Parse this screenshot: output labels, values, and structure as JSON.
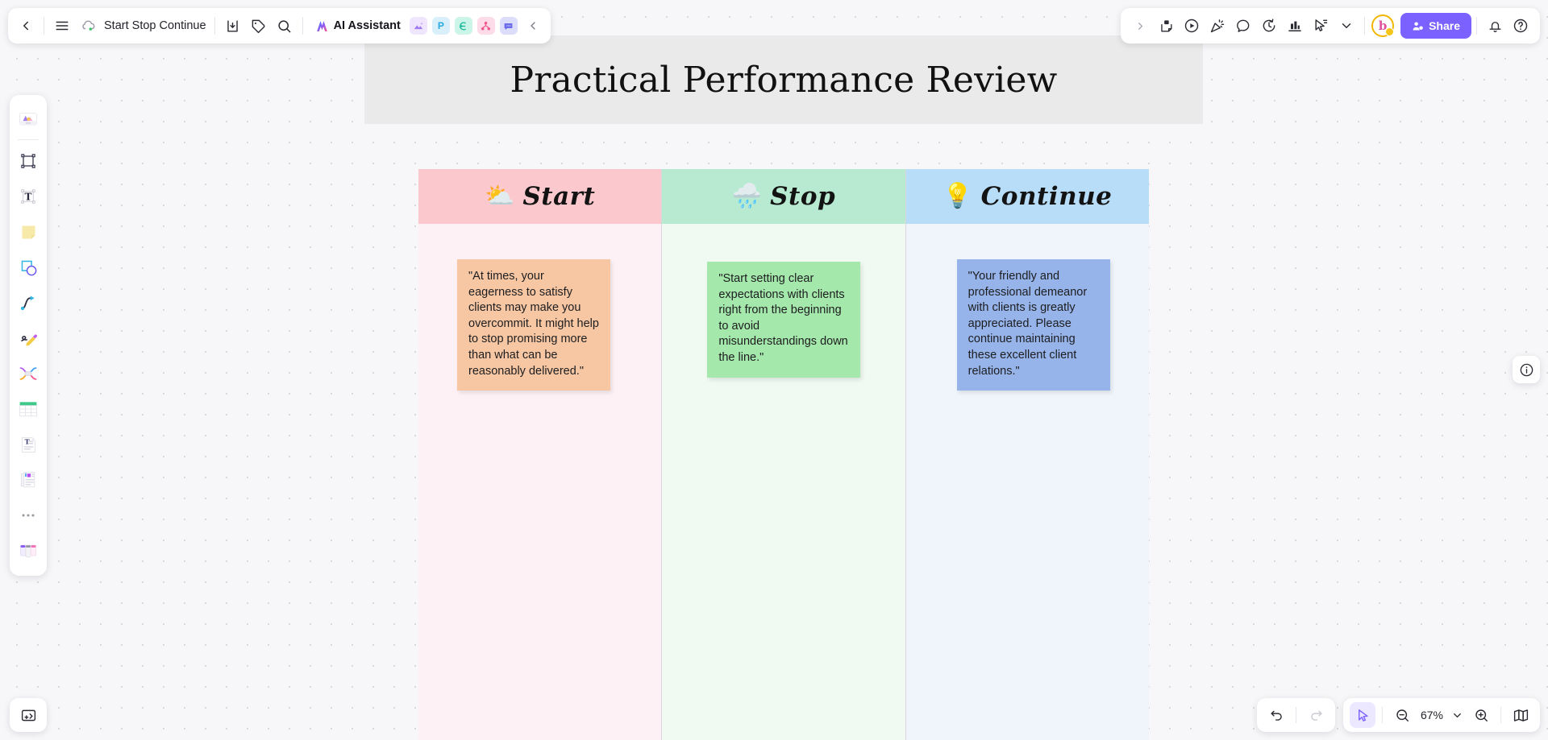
{
  "app": {
    "file_name": "Start Stop Continue",
    "zoom_level": "67%"
  },
  "topbar": {
    "back_label": "Back",
    "menu_label": "Menu",
    "cloud_status_label": "Saved to cloud",
    "import_label": "Import",
    "tag_label": "Tag",
    "search_label": "Search",
    "ai_assistant_label": "AI Assistant",
    "apps": [
      {
        "name": "image-generator-app",
        "glyph": "",
        "bg": "#efe6fd",
        "fg": "#9b6bf0"
      },
      {
        "name": "presentation-app",
        "glyph": "P",
        "bg": "#d9f0fb",
        "fg": "#2aa8e0"
      },
      {
        "name": "flowchart-app",
        "glyph": "",
        "bg": "#ccf5ea",
        "fg": "#17b897"
      },
      {
        "name": "mindmap-app",
        "glyph": "",
        "bg": "#fddbe8",
        "fg": "#f0588f"
      },
      {
        "name": "comments-app",
        "glyph": "",
        "bg": "#dcddfb",
        "fg": "#6a6ce8"
      }
    ],
    "collapse_label": "Collapse"
  },
  "topright": {
    "expand_label": "Expand",
    "tools": [
      {
        "name": "sticky-lock-icon",
        "label": "Lock note"
      },
      {
        "name": "play-circle-icon",
        "label": "Play"
      },
      {
        "name": "party-popper-icon",
        "label": "Celebrate"
      },
      {
        "name": "comment-bubble-icon",
        "label": "Comment"
      },
      {
        "name": "timer-icon",
        "label": "Timer"
      },
      {
        "name": "vote-chart-icon",
        "label": "Voting"
      },
      {
        "name": "presenter-cursor-icon",
        "label": "Presentation mode"
      },
      {
        "name": "chevron-down-icon",
        "label": "More"
      }
    ],
    "avatar_initial": "b",
    "share_label": "Share",
    "notifications_label": "Notifications",
    "help_label": "Help"
  },
  "lefttoolbar": {
    "items": [
      {
        "name": "templates-tool",
        "label": "Templates"
      },
      {
        "name": "frame-tool",
        "label": "Frame"
      },
      {
        "name": "text-tool",
        "label": "Text"
      },
      {
        "name": "sticky-note-tool",
        "label": "Sticky note"
      },
      {
        "name": "shapes-tool",
        "label": "Shapes"
      },
      {
        "name": "connector-tool",
        "label": "Connector"
      },
      {
        "name": "pen-tool",
        "label": "Pen"
      },
      {
        "name": "mindmap-tool",
        "label": "Mind map"
      },
      {
        "name": "table-tool",
        "label": "Table"
      },
      {
        "name": "textbox-tool",
        "label": "Text box"
      },
      {
        "name": "document-tool",
        "label": "Document"
      },
      {
        "name": "more-tools",
        "label": "More"
      },
      {
        "name": "kanban-tool",
        "label": "Kanban"
      }
    ],
    "upload_label": "Upload"
  },
  "rightpanel": {
    "info_label": "Board info"
  },
  "bottomright": {
    "undo_label": "Undo",
    "redo_label": "Redo",
    "select_label": "Select",
    "zoom_out_label": "Zoom out",
    "zoom_in_label": "Zoom in",
    "zoom_dropdown_label": "Zoom options",
    "minimap_label": "Minimap"
  },
  "board": {
    "title": "Practical Performance Review",
    "columns": [
      {
        "id": "start",
        "label": "Start",
        "emoji": "⛅",
        "emoji_name": "sun-behind-cloud-icon",
        "header_bg": "#fbc9cd",
        "body_bg": "#fdf1f5",
        "note": {
          "text": "\"At times, your eagerness to satisfy clients may make you overcommit. It might help to stop promising more than what can be reasonably delivered.\"",
          "bg": "#f7c7a4"
        }
      },
      {
        "id": "stop",
        "label": "Stop",
        "emoji": "🌧️",
        "emoji_name": "rain-cloud-icon",
        "header_bg": "#b7ead0",
        "body_bg": "#f0faf2",
        "note": {
          "text": "\"Start setting clear expectations with clients right from the beginning to avoid misunderstandings down the line.\"",
          "bg": "#a5e8ac"
        }
      },
      {
        "id": "continue",
        "label": "Continue",
        "emoji": "💡",
        "emoji_name": "lightbulb-icon",
        "header_bg": "#b8ddf8",
        "body_bg": "#f0f5fc",
        "note": {
          "text": "\"Your friendly and professional demeanor with clients is greatly appreciated. Please continue maintaining these excellent client relations.\"",
          "bg": "#96b4ea"
        }
      }
    ]
  }
}
